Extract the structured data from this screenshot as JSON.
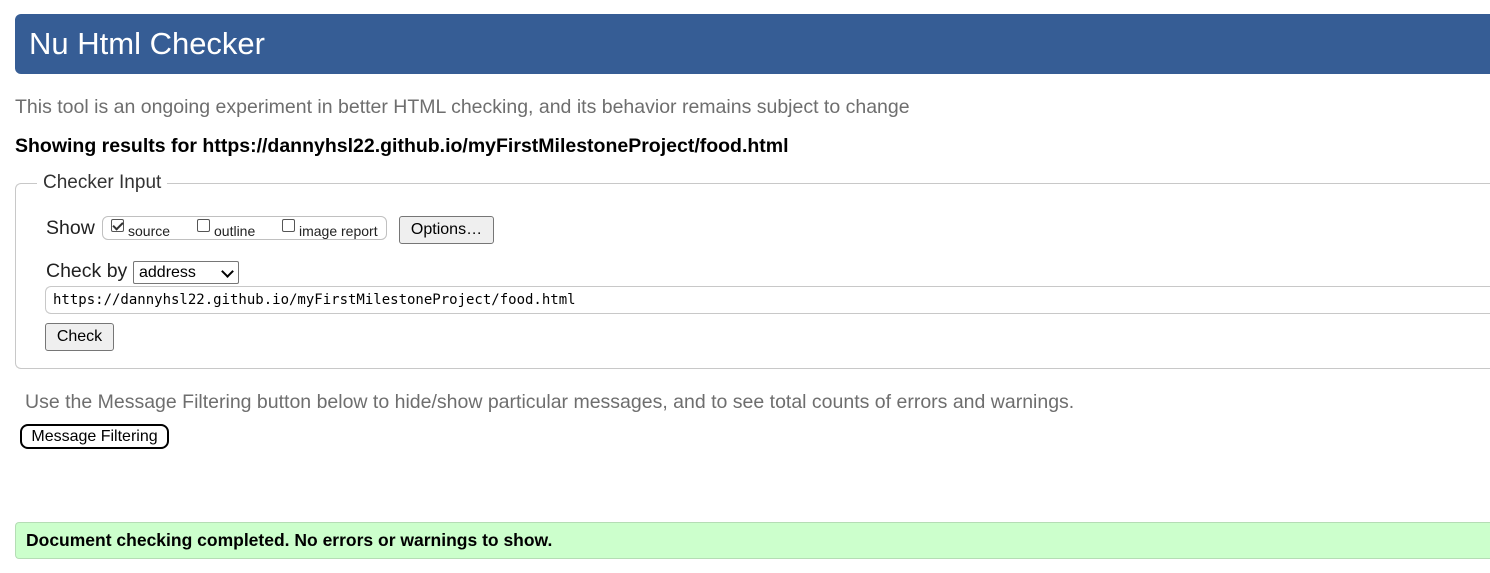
{
  "header": {
    "title": "Nu Html Checker"
  },
  "intro_text": "This tool is an ongoing experiment in better HTML checking, and its behavior remains subject to change",
  "results_heading": "Showing results for https://dannyhsl22.github.io/myFirstMilestoneProject/food.html",
  "checker_input": {
    "legend": "Checker Input",
    "show_label": "Show",
    "show_options": [
      {
        "label": "source",
        "checked": true
      },
      {
        "label": "outline",
        "checked": false
      },
      {
        "label": "image report",
        "checked": false
      }
    ],
    "options_button": "Options…",
    "check_by_label": "Check by",
    "check_by_selected": "address",
    "url_value": "https://dannyhsl22.github.io/myFirstMilestoneProject/food.html",
    "check_button": "Check"
  },
  "filtering": {
    "note": "Use the Message Filtering button below to hide/show particular messages, and to see total counts of errors and warnings.",
    "button": "Message Filtering"
  },
  "status_message": "Document checking completed. No errors or warnings to show.",
  "colors": {
    "header_bg": "#365d95",
    "success_bg": "#ccffcc"
  },
  "icons": {
    "select_arrow": "chevron-down-icon",
    "checkbox_checked": "checkmark-icon"
  }
}
